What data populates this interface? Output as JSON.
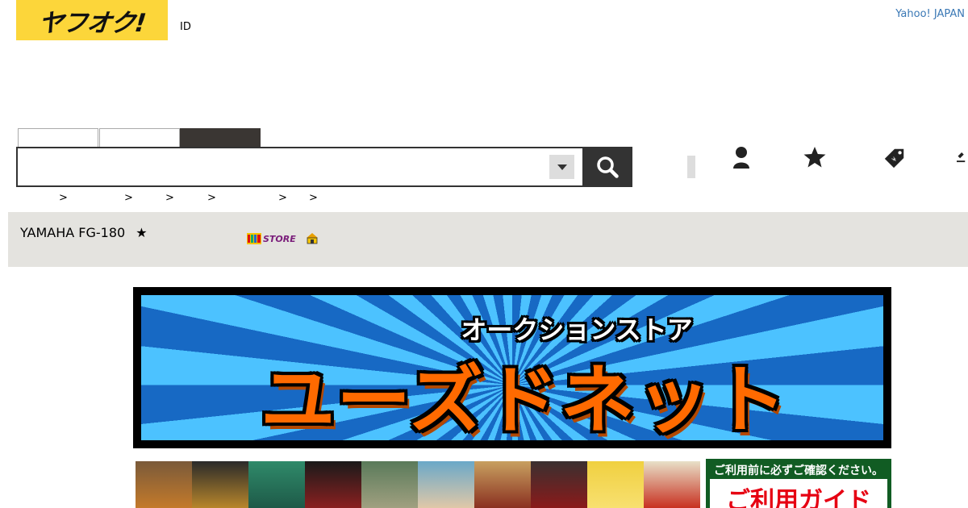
{
  "header": {
    "logo_text": "ヤフオク!",
    "id_label": "ID",
    "yahoo_japan_link": "Yahoo! JAPAN"
  },
  "search": {
    "tabs": [
      "",
      "",
      ""
    ],
    "input_value": "",
    "input_placeholder": "",
    "category_icon": "caret-down-icon",
    "button_icon": "search-icon"
  },
  "nav_icons": [
    "user-icon",
    "star-icon",
    "price-tag-icon",
    "gavel-icon"
  ],
  "breadcrumb": [
    ">",
    ">",
    ">",
    ">",
    ">",
    ">"
  ],
  "item": {
    "title": "YAMAHA FG-180",
    "star": "★",
    "store_badge": "STORE"
  },
  "banner": {
    "subtitle": "オークションストア",
    "title": "ユーズドネット"
  },
  "guide": {
    "top_text": "ご利用前に必ずご確認ください。",
    "main_text": "ご利用ガイド"
  },
  "colors": {
    "logo_bg": "#fcd63a",
    "search_button": "#333333",
    "title_band": "#e4e3df",
    "link": "#3a78b5",
    "banner_orange": "#ff6a00",
    "guide_green": "#115c23",
    "guide_red": "#e60012"
  }
}
